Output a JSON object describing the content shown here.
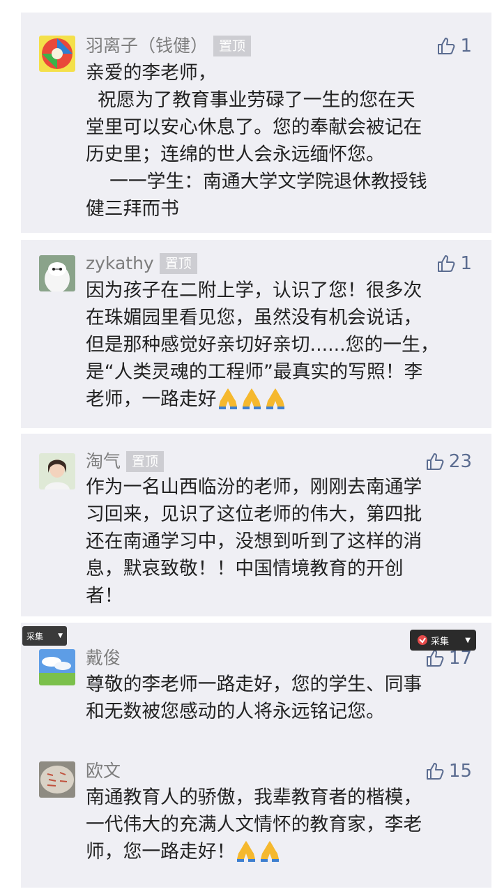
{
  "comments": [
    {
      "author": "羽离子（钱健）",
      "badge": "置顶",
      "likes": "1",
      "lines": [
        "亲爱的李老师，",
        "  祝愿为了教育事业劳碌了一生的您在天",
        "堂里可以安心休息了。您的奉献会被记在",
        "历史里；连绵的世人会永远缅怀您。",
        "    一一学生：南通大学文学院退休教授钱",
        "健三拜而书"
      ]
    },
    {
      "author": "zykathy",
      "badge": "置顶",
      "likes": "1",
      "lines": [
        "因为孩子在二附上学，认识了您！很多次",
        "在珠媚园里看见您，虽然没有机会说话，",
        "但是那种感觉好亲切好亲切......您的一生，",
        "是“人类灵魂的工程师”最真实的写照！李",
        "老师，一路走好"
      ]
    },
    {
      "author": "淘气",
      "badge": "置顶",
      "likes": "23",
      "lines": [
        "作为一名山西临汾的老师，刚刚去南通学",
        "习回来，见识了这位老师的伟大，第四批",
        "还在南通学习中，没想到听到了这样的消",
        "息，默哀致敬！！中国情境教育的开创",
        "者！"
      ]
    },
    {
      "author": "戴俊",
      "likes": "17",
      "lines": [
        "尊敬的李老师一路走好，您的学生、同事",
        "和无数被您感动的人将永远铭记您。"
      ]
    },
    {
      "author": "欧文",
      "likes": "15",
      "lines": [
        "南通教育人的骄傲，我辈教育者的楷模，",
        "一代伟大的充满人文情怀的教育家，李老",
        "师，您一路走好！"
      ]
    }
  ],
  "overlay": {
    "collect_left": "采集",
    "collect_right": "采集"
  },
  "colors": {
    "card_bg": "#efeff4",
    "name": "#7d7d7d",
    "like": "#5b6c90",
    "badge_bg": "#cdcdd2"
  },
  "icons": [
    "thumbs-up-icon",
    "praying-hands-icon",
    "caret-down-icon"
  ]
}
